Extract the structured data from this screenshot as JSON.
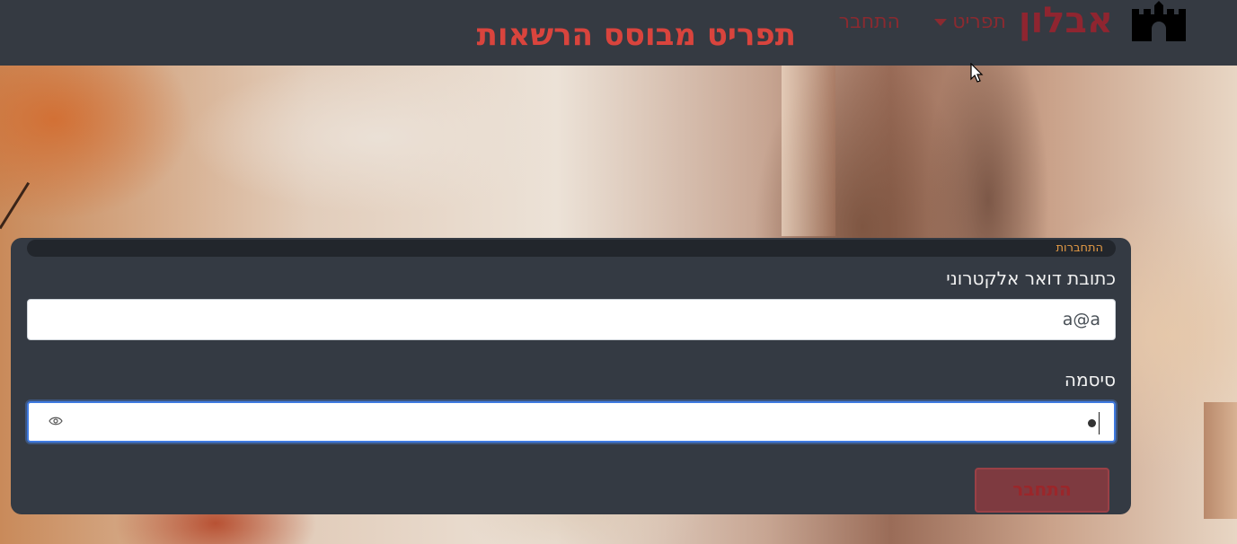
{
  "header": {
    "logo_icon": "castle-icon",
    "brand": "אבלון",
    "menu_label": "תפריט",
    "login_link": "התחבר",
    "title": "תפריט מבוסס הרשאות"
  },
  "login": {
    "section_label": "התחברות",
    "email_label": "כתובת דואר אלקטרוני",
    "email_value": "a@a",
    "password_label": "סיסמה",
    "password_mask": "•",
    "password_toggle_icon": "eye-icon",
    "submit_label": "התחבר"
  },
  "colors": {
    "topbar": "#353a42",
    "brand": "#8f2530",
    "title": "#d9443d",
    "section_label": "#e39a45",
    "submit_bg": "#7e3a40",
    "focus_border": "#3f7ae0"
  }
}
